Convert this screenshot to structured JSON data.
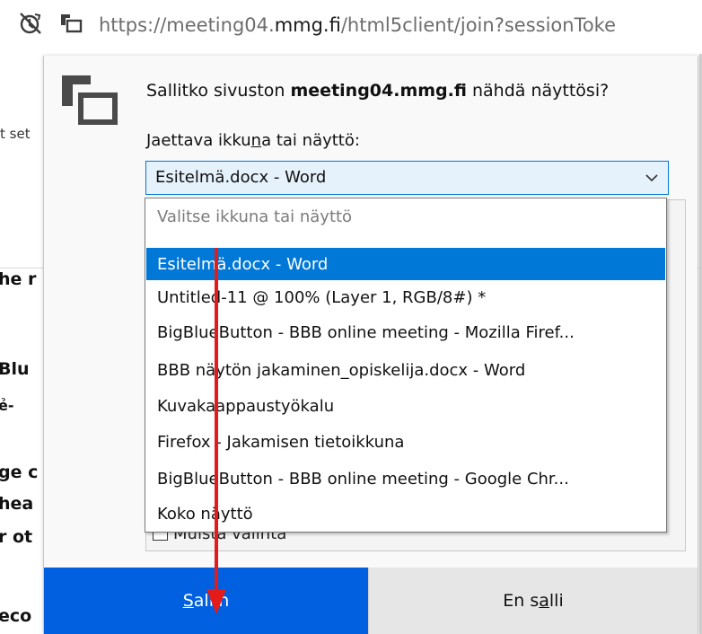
{
  "url_bar": {
    "url_prefix": "https://meeting04.",
    "url_host": "mmg.fi",
    "url_suffix": "/html5client/join?sessionToke",
    "permissions_icon": "permissions-icon",
    "screen_share_icon": "screen-share-icon"
  },
  "background_page": {
    "fragments": [
      "t set",
      "he r",
      "Blu",
      "ẻ-",
      "ge c",
      "hea",
      "r ot",
      "eco"
    ]
  },
  "panel": {
    "question_prefix": "Sallitko sivuston ",
    "question_host": "meeting04.mmg.fi",
    "question_suffix": " nähdä näyttösi?",
    "select_label_pre": "Jaettava ikku",
    "select_label_accel": "n",
    "select_label_post": "a tai näyttö:",
    "selected_value": "Esitelmä.docx - Word",
    "remember_label": "Muista valinta",
    "options": [
      "Valitse ikkuna tai näyttö",
      "Esitelmä.docx - Word",
      "Untitled-11 @ 100% (Layer 1, RGB/8#) *",
      "BigBlueButton - BBB online meeting - Mozilla Firef...",
      "BBB näytön jakaminen_opiskelija.docx - Word",
      "Kuvakaappaustyökalu",
      "Firefox - Jakamisen tietoikkuna",
      "BigBlueButton - BBB online meeting - Google Chr...",
      "Koko näyttö"
    ],
    "allow_accel": "S",
    "allow_rest": "allin",
    "deny_pre": "En s",
    "deny_accel": "a",
    "deny_post": "lli"
  },
  "colors": {
    "accent": "#0060df",
    "selection": "#0078d7",
    "annotation_arrow": "#e31b1b"
  }
}
